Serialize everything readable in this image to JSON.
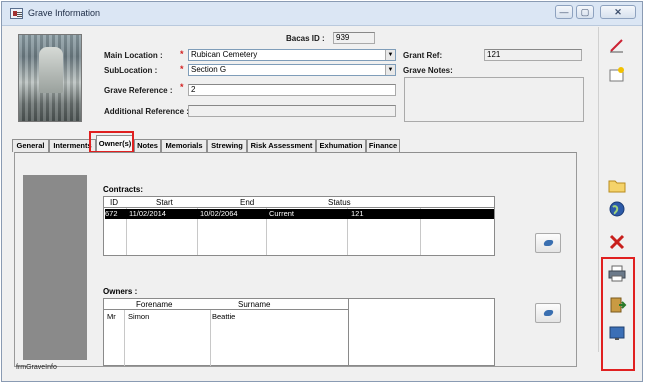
{
  "window": {
    "title": "Grave Information",
    "minimize": "—",
    "maximize": "▢",
    "close": "✕"
  },
  "header": {
    "bacas_id_label": "Bacas ID :",
    "bacas_id_value": "939",
    "main_location_label": "Main Location :",
    "main_location_value": "Rubican Cemetery",
    "sublocation_label": "SubLocation :",
    "sublocation_value": "Section G",
    "grave_reference_label": "Grave Reference :",
    "grave_reference_value": "2",
    "additional_reference_label": "Additional Reference :",
    "additional_reference_value": "",
    "grant_ref_label": "Grant Ref:",
    "grant_ref_value": "121",
    "grave_notes_label": "Grave Notes:",
    "required_mark": "*",
    "combo_arrow": "▼"
  },
  "tabs": [
    {
      "label": "General"
    },
    {
      "label": "Interments"
    },
    {
      "label": "Owner(s)"
    },
    {
      "label": "Notes"
    },
    {
      "label": "Memorials"
    },
    {
      "label": "Strewing"
    },
    {
      "label": "Risk Assessment"
    },
    {
      "label": "Exhumation"
    },
    {
      "label": "Finance"
    }
  ],
  "active_tab": "Owner(s)",
  "contracts": {
    "label": "Contracts:",
    "columns": [
      "ID",
      "Start",
      "End",
      "Status"
    ],
    "rows": [
      {
        "id": "672",
        "start": "11/02/2014",
        "end": "10/02/2064",
        "status": "Current",
        "ref": "121"
      }
    ]
  },
  "owners": {
    "label": "Owners :",
    "columns": [
      "Forename",
      "Surname"
    ],
    "rows": [
      {
        "title": "Mr",
        "forename": "Simon",
        "surname": "Beattie"
      }
    ]
  },
  "status_bar": {
    "form_name": "frmGraveInfo"
  },
  "right_toolbar": [
    {
      "icon": "edit-icon"
    },
    {
      "icon": "new-record-icon"
    },
    {
      "icon": "folder-icon"
    },
    {
      "icon": "globe-icon"
    },
    {
      "icon": "delete-icon"
    },
    {
      "icon": "print-icon"
    },
    {
      "icon": "exit-icon"
    },
    {
      "icon": "screen-icon"
    }
  ],
  "colors": {
    "highlight": "#e02020",
    "selected_row": "#000000"
  }
}
